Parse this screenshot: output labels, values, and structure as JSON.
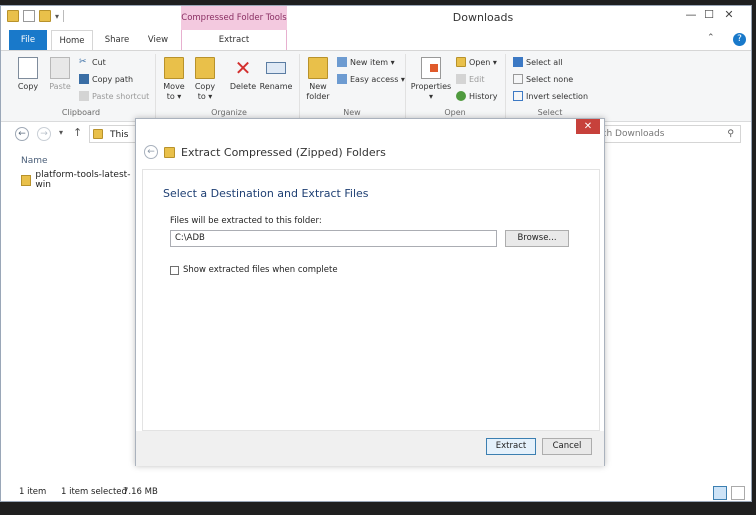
{
  "window": {
    "title": "Downloads",
    "contextual_tab_group": "Compressed Folder Tools"
  },
  "ribbon_tabs": {
    "file": "File",
    "home": "Home",
    "share": "Share",
    "view": "View",
    "extract": "Extract"
  },
  "ribbon": {
    "clipboard": {
      "label": "Clipboard",
      "copy": "Copy",
      "paste": "Paste",
      "cut": "Cut",
      "copy_path": "Copy path",
      "paste_shortcut": "Paste shortcut"
    },
    "organize": {
      "label": "Organize",
      "move_to_1": "Move",
      "move_to_2": "to ▾",
      "copy_to_1": "Copy",
      "copy_to_2": "to ▾",
      "delete": "Delete",
      "rename": "Rename"
    },
    "new": {
      "label": "New",
      "new_folder_1": "New",
      "new_folder_2": "folder",
      "new_item": "New item ▾",
      "easy_access": "Easy access ▾"
    },
    "open": {
      "label": "Open",
      "properties": "Properties",
      "properties_arrow": "▾",
      "open": "Open ▾",
      "edit": "Edit",
      "history": "History"
    },
    "select": {
      "label": "Select",
      "select_all": "Select all",
      "select_none": "Select none",
      "invert_selection": "Invert selection"
    }
  },
  "address": {
    "path_fragment": "This",
    "search_placeholder": "rch Downloads"
  },
  "file_list": {
    "column_name": "Name",
    "items": [
      "platform-tools-latest-win"
    ]
  },
  "status": {
    "item_count": "1 item",
    "selected": "1 item selected",
    "size": "7.16 MB"
  },
  "dialog": {
    "title": "Extract Compressed (Zipped) Folders",
    "heading": "Select a Destination and Extract Files",
    "field_label": "Files will be extracted to this folder:",
    "path_value": "C:\\ADB",
    "browse_button": "Browse...",
    "checkbox_label": "Show extracted files when complete",
    "checkbox_checked": false,
    "extract_button": "Extract",
    "cancel_button": "Cancel",
    "close_glyph": "✕"
  },
  "colors": {
    "file_tab": "#1979ca",
    "context_tab": "#f3c9df",
    "close_button": "#c7413b",
    "dialog_heading": "#1e3f73"
  }
}
